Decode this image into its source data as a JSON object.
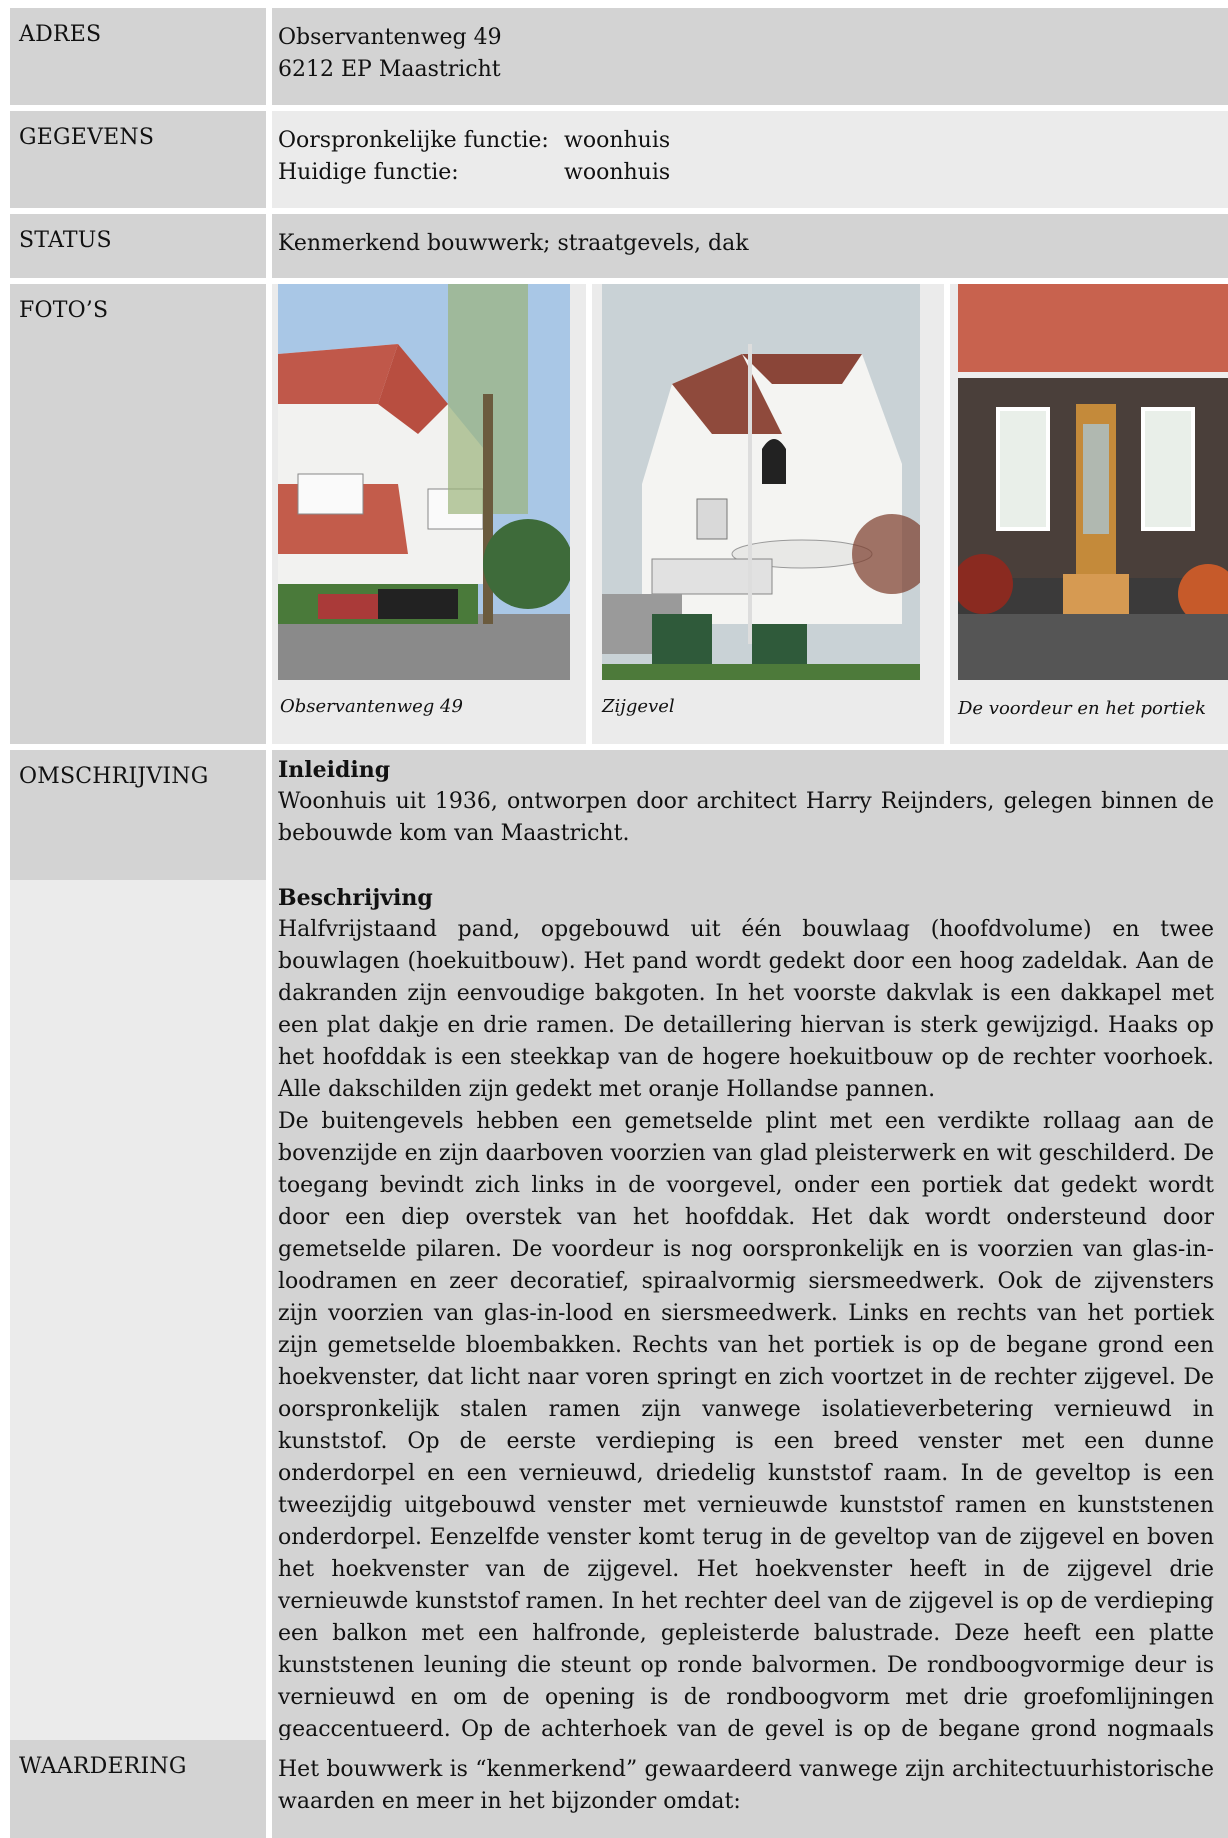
{
  "sections": {
    "adres": {
      "label": "ADRES",
      "line1": "Observantenweg 49",
      "line2": "6212 EP Maastricht"
    },
    "gegevens": {
      "label": "GEGEVENS",
      "rows": [
        {
          "key": "Oorspronkelijke functie:",
          "value": "woonhuis"
        },
        {
          "key": "Huidige functie:",
          "value": "woonhuis"
        }
      ]
    },
    "status": {
      "label": "STATUS",
      "text": "Kenmerkend bouwwerk; straatgevels, dak"
    },
    "fotos": {
      "label": "FOTO’S",
      "photos": [
        {
          "caption": "Observantenweg 49",
          "icon": "house-front-photo"
        },
        {
          "caption": "Zijgevel",
          "icon": "house-side-photo"
        },
        {
          "caption": "De voordeur en het portiek",
          "icon": "front-door-photo"
        }
      ]
    },
    "omschrijving": {
      "label": "OMSCHRIJVING",
      "heading1": "Inleiding",
      "intro": "Woonhuis uit 1936, ontworpen door architect Harry Reijnders, gelegen binnen de bebouwde kom van Maastricht.",
      "heading2": "Beschrijving",
      "para1": "Halfvrijstaand pand, opgebouwd uit één bouwlaag (hoofdvolume) en twee bouwlagen (hoekuitbouw). Het pand wordt gedekt door een hoog zadeldak. Aan de dakranden zijn eenvoudige bakgoten. In het voorste dakvlak is een dakkapel met een plat dakje en drie ramen. De detaillering hiervan is sterk gewijzigd.  Haaks op het hoofddak is een steekkap van de hogere hoekuitbouw op de rechter voorhoek. Alle dakschilden zijn gedekt met oranje Hollandse pannen.",
      "para2": "De buitengevels hebben een gemetselde plint met een verdikte rollaag aan de bovenzijde en zijn daarboven voorzien van glad pleisterwerk en wit geschilderd. De toegang bevindt zich links in de voorgevel, onder een portiek dat gedekt wordt door een diep overstek van het hoofddak. Het dak wordt ondersteund door gemetselde pilaren. De voordeur is nog oorspronkelijk en is voorzien van glas-in-loodramen en zeer decoratief, spiraalvormig siersmeedwerk. Ook de zijvensters zijn voorzien van glas-in-lood en siersmeedwerk. Links en rechts van het portiek zijn gemetselde bloembakken. Rechts van het portiek is op de begane grond een hoekvenster, dat licht naar voren springt en zich voortzet in de rechter zijgevel. De oorspronkelijk stalen ramen zijn vanwege isolatieverbetering vernieuwd in kunststof. Op de eerste verdieping is een breed venster met een dunne onderdorpel en een vernieuwd, driedelig kunststof raam. In de geveltop is een tweezijdig uitgebouwd venster met vernieuwde kunststof ramen en kunststenen onderdorpel. Eenzelfde venster komt terug in de geveltop van de zijgevel en boven het hoekvenster van de zijgevel. Het hoekvenster heeft in de zijgevel drie vernieuwde kunststof ramen. In het rechter deel van de zijgevel is op de verdieping een balkon met een halfronde, gepleisterde balustrade. Deze heeft een platte kunststenen leuning die steunt op ronde balvormen. De rondboogvormige deur is vernieuwd en om de opening is de rondboogvorm met drie groefomlijningen geaccentueerd. Op de achterhoek van de gevel is op de begane grond nogmaals een hoekvenster, met vernieuwde kunststof ramen."
    },
    "waardering": {
      "label": "WAARDERING",
      "text": "Het bouwwerk is “kenmerkend” gewaardeerd vanwege zijn architectuurhistorische waarden en meer in het bijzonder omdat:"
    }
  }
}
